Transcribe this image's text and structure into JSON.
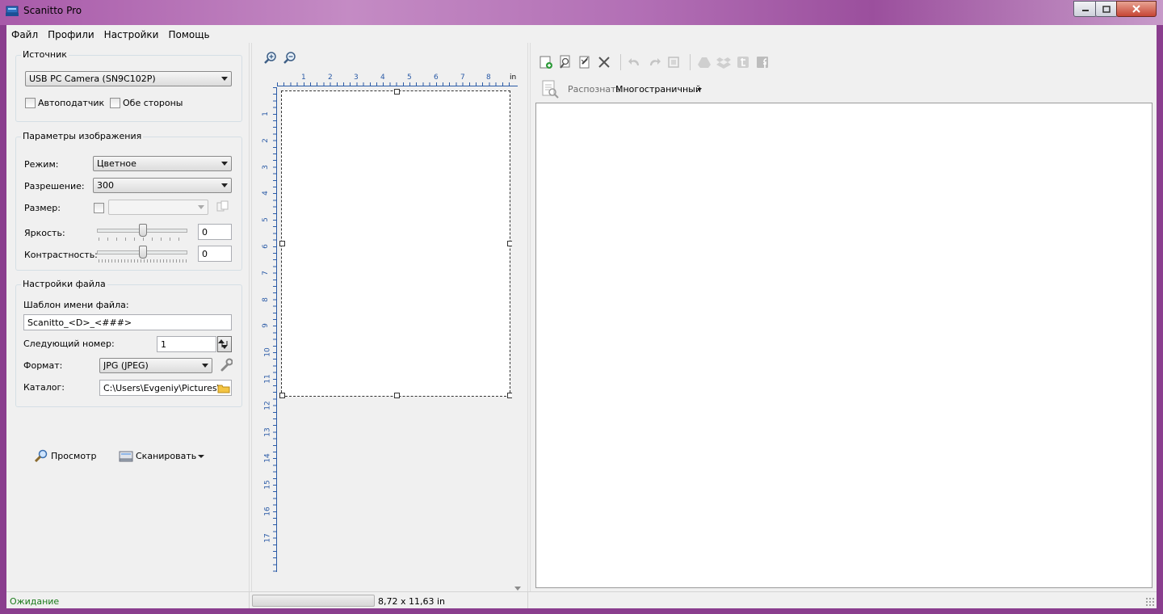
{
  "window": {
    "title": "Scanitto Pro",
    "accent_color": "#2a5aa6"
  },
  "menu": [
    "Файл",
    "Профили",
    "Настройки",
    "Помощь"
  ],
  "source_group": {
    "title": "Источник",
    "device": "USB PC Camera (SN9C102P)",
    "autofeeder_label": "Автоподатчик",
    "duplex_label": "Обе стороны"
  },
  "image_group": {
    "title": "Параметры изображения",
    "mode_label": "Режим:",
    "mode_value": "Цветное",
    "resolution_label": "Разрешение:",
    "resolution_value": "300",
    "size_label": "Размер:",
    "size_value": "",
    "brightness_label": "Яркость:",
    "brightness_value": "0",
    "contrast_label": "Контрастность:",
    "contrast_value": "0"
  },
  "file_group": {
    "title": "Настройки файла",
    "template_label": "Шаблон имени файла:",
    "template_value": "Scanitto_<D>_<###>",
    "next_number_label": "Следующий номер:",
    "next_number_value": "1",
    "format_label": "Формат:",
    "format_value": "JPG (JPEG)",
    "folder_label": "Каталог:",
    "folder_value": "C:\\Users\\Evgeniy\\Pictures\\Sca"
  },
  "actions": {
    "preview_label": "Просмотр",
    "scan_label": "Сканировать"
  },
  "preview": {
    "ruler_unit": "in",
    "h_ticks": [
      "1",
      "2",
      "3",
      "4",
      "5",
      "6",
      "7",
      "8"
    ],
    "v_ticks": [
      "1",
      "2",
      "3",
      "4",
      "5",
      "6",
      "7",
      "8",
      "9",
      "10",
      "11",
      "12",
      "13",
      "14",
      "15",
      "16",
      "17"
    ]
  },
  "results": {
    "recognize_label": "Распознать",
    "multipage_label": "Многостраничный"
  },
  "status": {
    "state": "Ожидание",
    "state_color": "#1a7a1a",
    "dimensions": "8,72 x 11,63 in"
  }
}
